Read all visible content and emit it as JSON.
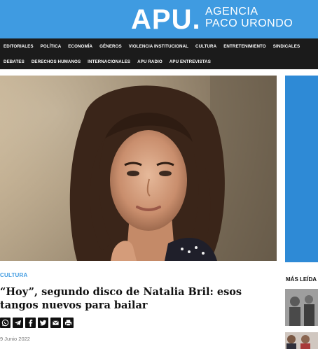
{
  "header": {
    "logo_main": "APU.",
    "logo_line1": "AGENCIA",
    "logo_line2": "PACO URONDO",
    "background": "#3f9be1"
  },
  "nav": {
    "row1": [
      "EDITORIALES",
      "POLÍTICA",
      "ECONOMÍA",
      "GÉNEROS",
      "VIOLENCIA INSTITUCIONAL",
      "CULTURA",
      "ENTRETENIMIENTO",
      "SINDICALES"
    ],
    "row2": [
      "DEBATES",
      "DERECHOS HUMANOS",
      "INTERNACIONALES",
      "APU RADIO",
      "APU ENTREVISTAS"
    ]
  },
  "article": {
    "category": "CULTURA",
    "headline": "“Hoy”, segundo disco de Natalia Bril: esos tangos nuevos para bailar",
    "date": "9 Junio 2022",
    "share_icons": [
      "whatsapp-icon",
      "telegram-icon",
      "facebook-icon",
      "twitter-icon",
      "email-icon",
      "print-icon"
    ]
  },
  "sidebar": {
    "title": "MÁS LEÍDA"
  },
  "colors": {
    "accent": "#3f9be1",
    "nav_bg": "#1b1b1b"
  }
}
